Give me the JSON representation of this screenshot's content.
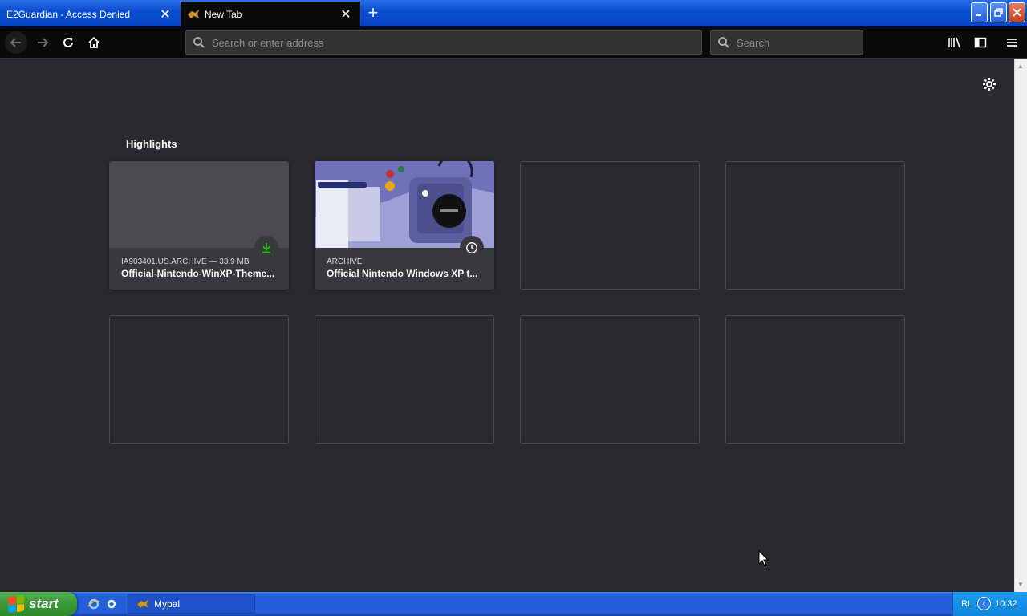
{
  "browser": {
    "tabs": [
      {
        "label": "E2Guardian - Access Denied",
        "active": false
      },
      {
        "label": "New Tab",
        "active": true
      }
    ],
    "urlbar_placeholder": "Search or enter address",
    "searchbar_placeholder": "Search"
  },
  "newtab": {
    "section_title": "Highlights",
    "highlights": [
      {
        "meta": "IA903401.US.ARCHIVE — 33.9 MB",
        "title": "Official-Nintendo-WinXP-Theme...",
        "badge": "download-icon"
      },
      {
        "meta": "ARCHIVE",
        "title": "Official Nintendo Windows XP t...",
        "badge": "clock-icon"
      }
    ]
  },
  "taskbar": {
    "start_label": "start",
    "task_label": "Mypal",
    "language": "RL",
    "clock": "10:32"
  },
  "colors": {
    "page_bg": "#2a2a2e",
    "toolbar_bg": "#0a0a0c",
    "xp_blue": "#245edb",
    "start_green": "#3d9b3a",
    "download_green": "#12bc00"
  }
}
